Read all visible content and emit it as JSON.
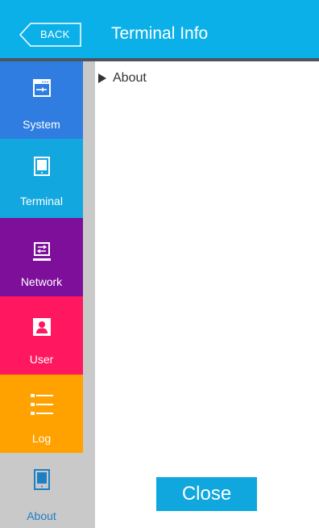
{
  "header": {
    "back_label": "BACK",
    "title": "Terminal Info"
  },
  "sidebar": {
    "items": [
      {
        "label": "System",
        "icon": "system-icon",
        "color": "#2f7de1"
      },
      {
        "label": "Terminal",
        "icon": "terminal-icon",
        "color": "#12a7de"
      },
      {
        "label": "Network",
        "icon": "network-icon",
        "color": "#7d0f9b"
      },
      {
        "label": "User",
        "icon": "user-icon",
        "color": "#ff1760"
      },
      {
        "label": "Log",
        "icon": "log-icon",
        "color": "#ffa200"
      },
      {
        "label": "About",
        "icon": "about-icon",
        "color": "#c9c9c9",
        "selected": true
      }
    ]
  },
  "content": {
    "tree_item_label": "About"
  },
  "footer": {
    "close_label": "Close"
  },
  "colors": {
    "header_bg": "#0bb0e8",
    "header_divider": "#4a5560",
    "accent": "#0fa7de"
  }
}
